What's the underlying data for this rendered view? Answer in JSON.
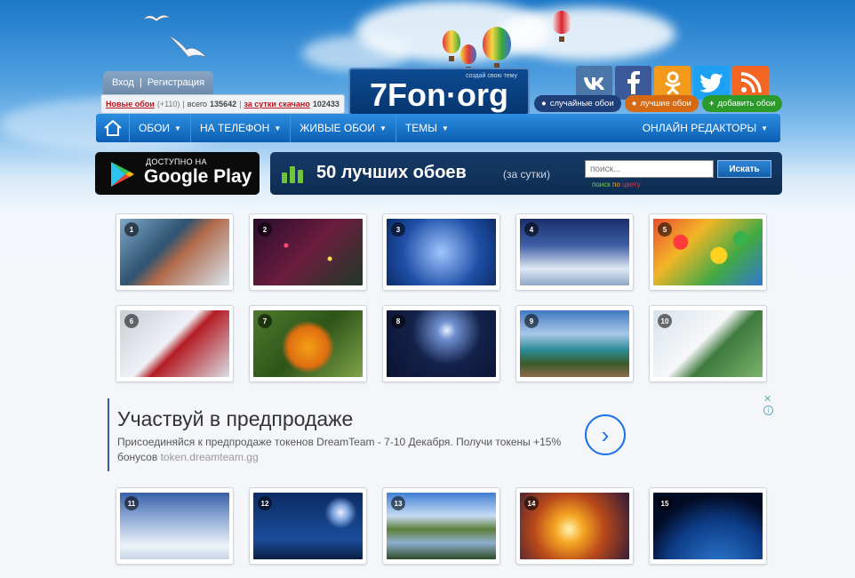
{
  "auth": {
    "login": "Вход",
    "separator": "|",
    "register": "Регистрация"
  },
  "logo": {
    "tagline": "создай свою тему",
    "name": "7Fon·org"
  },
  "social": [
    {
      "icon": "vk-icon",
      "glyph": "vk",
      "color": "#4a76a8"
    },
    {
      "icon": "facebook-icon",
      "glyph": "f",
      "color": "#3b5998"
    },
    {
      "icon": "odnoklassniki-icon",
      "glyph": "ок",
      "color": "#f39a1d"
    },
    {
      "icon": "twitter-icon",
      "glyph": "t",
      "color": "#1da1f2"
    },
    {
      "icon": "rss-icon",
      "glyph": "rss",
      "color": "#f26522"
    }
  ],
  "stats": {
    "new_label": "Новые обои",
    "new_count": "(+110)",
    "total_label": "всего",
    "total_value": "135642",
    "downloaded_label": "за сутки скачано",
    "downloaded_value": "102433"
  },
  "pills": [
    {
      "label": "случайные обои",
      "color": "#1f3f78"
    },
    {
      "label": "лучшие обои",
      "color": "#d66a13"
    },
    {
      "label": "добавить обои",
      "color": "#2b9a2b"
    }
  ],
  "nav": {
    "items": [
      "ОБОИ",
      "НА ТЕЛЕФОН",
      "ЖИВЫЕ ОБОИ",
      "ТЕМЫ"
    ],
    "right": "ОНЛАЙН РЕДАКТОРЫ"
  },
  "gplay": {
    "small": "ДОСТУПНО НА",
    "big": "Google Play"
  },
  "best": {
    "title": "50 лучших обоев",
    "subtitle": "(за сутки)",
    "search_placeholder": "поиск...",
    "search_button": "Искать",
    "color_search": {
      "w1": "поиск",
      "w2": "по",
      "w3": "цвету"
    }
  },
  "thumbs": [
    {
      "n": "1",
      "bg": "linear-gradient(135deg,#7ea8c9,#2d5370 40%,#b06a4a 55%,#d9e6f0)"
    },
    {
      "n": "2",
      "bg": "radial-gradient(circle at 30% 40%,#ff4b7c 2px,transparent 3px),radial-gradient(circle at 70% 60%,#ffe04b 2px,transparent 3px),linear-gradient(135deg,#2a0d2e,#6b1d3d,#1e3a2a)"
    },
    {
      "n": "3",
      "bg": "radial-gradient(circle at 50% 50%,#9fc5ff,#1f4fa6 60%,#0c2c6a)"
    },
    {
      "n": "4",
      "bg": "linear-gradient(180deg,#1a2f6b,#3e5fa6 40%,#dfe8f3 75%,#8ca8c7)"
    },
    {
      "n": "5",
      "bg": "radial-gradient(circle at 25% 35%,#ff3b3b 8px,transparent 9px),radial-gradient(circle at 60% 55%,#ffd21f 9px,transparent 10px),radial-gradient(circle at 80% 30%,#37b24d 8px,transparent 9px),linear-gradient(135deg,#e94d2f,#f2b627,#43a943,#3277d1)"
    },
    {
      "n": "6",
      "bg": "linear-gradient(135deg,#c9ced6,#eef1f5 45%,#b51c25 55%,#d9dde3)"
    },
    {
      "n": "7",
      "bg": "radial-gradient(circle at 50% 55%,#f3a116,#e06d10 30%,transparent 40%),linear-gradient(135deg,#4e7a2d,#2e5418,#7ea34a)"
    },
    {
      "n": "8",
      "bg": "radial-gradient(circle at 55% 30%,#e9f1ff,#6f8fd0 12%,#13224a 45%,#0a1330)"
    },
    {
      "n": "9",
      "bg": "linear-gradient(180deg,#3f79c2,#a9c8e8 35%,#2a8a93 60%,#3b5a2a 80%,#8c6b4a)"
    },
    {
      "n": "10",
      "bg": "linear-gradient(135deg,#d8e2ea,#f6f8fa 45%,#3e7a3e 60%,#7ab36b)"
    },
    {
      "n": "11",
      "bg": "linear-gradient(180deg,#3a5fa8,#9fb8dd 45%,#eef3f9 80%,#c7d4e6)"
    },
    {
      "n": "12",
      "bg": "radial-gradient(circle at 80% 30%,#e6eefc,#7ea4df 8%,transparent 16%),linear-gradient(180deg,#0c2b64,#1b4d9a 70%,#0a1e44)"
    },
    {
      "n": "13",
      "bg": "linear-gradient(180deg,#3f7fd4,#c7dcf3 35%,#5c7f3a 55%,#8fb0cf 75%,#2e4c26)"
    },
    {
      "n": "14",
      "bg": "radial-gradient(circle at 45% 55%,#fff3b0,#f5a623 20%,#b8481a 50%,#2b1a3a)"
    },
    {
      "n": "15",
      "bg": "radial-gradient(circle at 60% 120%,#2f7fd6,#0d3c86 50%,#020b24 75%)"
    }
  ],
  "ad": {
    "headline": "Участвуй в предпродаже",
    "body": "Присоединяйся к предпродаже токенов DreamTeam - 7-10 Декабря. Получи токены +15% бонусов",
    "url": "token.dreamteam.gg",
    "arrow": "›"
  }
}
